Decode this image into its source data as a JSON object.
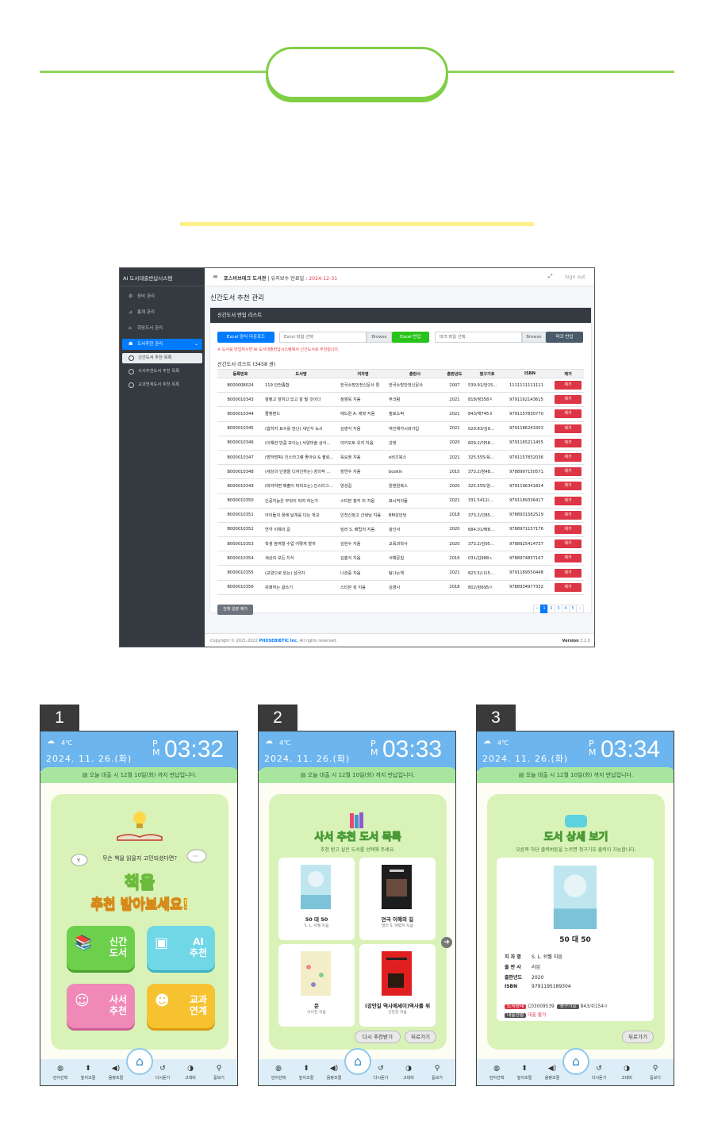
{
  "admin": {
    "brand": "AI 도서대출반납시스템",
    "sidebar": [
      {
        "label": "장비 관리",
        "icon": "gear-icon"
      },
      {
        "label": "통계 관리",
        "icon": "chart-icon"
      },
      {
        "label": "희망도서 관리",
        "icon": "gift-icon"
      },
      {
        "label": "도서추천 관리",
        "icon": "users-icon"
      }
    ],
    "submenu": [
      "신간도서 추천 목록",
      "사서추천도서 추천 목록",
      "교과연계도서 추천 목록"
    ],
    "topnav": {
      "school": "포스비브테크 도서관",
      "maint_label": "| 유지보수 만료일 :",
      "maint_date": "2024-12-31",
      "signout": "Sign out"
    },
    "page_title": "신간도서 추천 관리",
    "card_title": "신간도서 반입 리스트",
    "excel_download": "Excel 양식 다운로드",
    "excel_file_placeholder": "Excel 파일 선택",
    "browse": "Browse",
    "excel_import": "Excel 반입",
    "marc_file_placeholder": "마크 파일 선택",
    "marc_import": "마크 반입",
    "notice": "※ 도서를 반입하시면 AI 도서대출반납시스템에서 신간도서로 추천됩니다.",
    "list_title": "신간도서 리스트 (3458 권)",
    "columns": [
      "등록번호",
      "도서명",
      "저자명",
      "출판사",
      "출판년도",
      "청구기호",
      "ISBN",
      "제거"
    ],
    "remove": "제거",
    "rows": [
      [
        "B000008024",
        "119 안전종합",
        "한국소방안전신문사 편",
        "한국소방안전신문사",
        "2007",
        "539.91/한15…",
        "1111111111111"
      ],
      [
        "B000010343",
        "잘됐고 잘하고 있고 잘 될 것이다",
        "정영욱 지음",
        "부크럼",
        "2021",
        "818/정358ㅈ",
        "9791162143615"
      ],
      [
        "B000010344",
        "플랫랜드",
        "에드윈 A. 애벗 지음",
        "필로소픽",
        "2021",
        "843/애745ㅍ",
        "9791157830770"
      ],
      [
        "B000010345",
        "(쉽하지 표수를 만난) 세인식 녹시",
        "김영식 지음",
        "여인채카시와가입",
        "2021",
        "029.83/김9…",
        "9791186243303"
      ],
      [
        "B000010346",
        "(이해한 만큼 보이는) 서양미술 상식…",
        "야키모토 유지 지음",
        "강벗",
        "2020",
        "609.2/야58…",
        "9791165211455"
      ],
      [
        "B000010347",
        "(멍하멍픽) 인스타그램 좋아요 & 팔로…",
        "육요정 지음",
        "e비즈북스",
        "2021",
        "325.555/육…",
        "9791157832036"
      ],
      [
        "B000010348",
        "(세상의 인생을 디자인하는) 창의적 …",
        "장연수 지음",
        "bookin",
        "2015",
        "373.2/장48…",
        "9788997150571"
      ],
      [
        "B000010349",
        "(따라하면 매출이 따라오는) 인스타그…",
        "양성길",
        "원앤원북스",
        "2020",
        "325.555/양…",
        "9791196341824"
      ],
      [
        "B000010350",
        "인공지능은 무엇이 되려 하는가",
        "스티븐 핑커 외 지음",
        "표시적의들",
        "2021",
        "331.5412/…",
        "9791189336417"
      ],
      [
        "B000010351",
        "아이들의 꿈에 날개를 다는 학교",
        "인천신정고 선생님 지음",
        "BM성안당",
        "2018",
        "373.2/인85…",
        "9788931582529"
      ],
      [
        "B000010352",
        "연극 이해의 길",
        "밀러 S. 배럽저 지음",
        "광인서",
        "2020",
        "684.01/배8…",
        "9788971157176"
      ],
      [
        "B000010353",
        "학생 참여형 수업 어떻게 할까",
        "김현수 지음",
        "교육과학사",
        "2020",
        "373.2/김95…",
        "9788925414737"
      ],
      [
        "B000010354",
        "세상의 모든 지식",
        "김흥식 지음",
        "서해문집",
        "2016",
        "031/김988ㅅ",
        "9788974837167"
      ],
      [
        "B000010355",
        "(교양으로 읽는) 삼국지",
        "나관중 지음",
        "탐나는책",
        "2021",
        "823.5/나15…",
        "9791189550448"
      ],
      [
        "B000010356",
        "유쾌하는 글쓰기",
        "스티븐 킹 지음",
        "김영사",
        "2018",
        "802/킹695ㅇ",
        "9788934977332"
      ]
    ],
    "delete_all": "전체 일괄 제거",
    "pages": [
      "‹",
      "1",
      "2",
      "3",
      "4",
      "5",
      "›"
    ],
    "copyright_prefix": "Copyright © 2021-2022",
    "copyright_company": "PHOSEBIBTIC Inc.",
    "copyright_suffix": "All rights reserved.",
    "version_label": "Version",
    "version": "3.2.0"
  },
  "phones": {
    "temp": "4℃",
    "date": "2024. 11. 26.(화)",
    "ampm": "P M",
    "times": [
      "03:32",
      "03:33",
      "03:34"
    ],
    "notice": "오늘 대출 시 12월 10일(화) 까지 반납입니다.",
    "nav": [
      "언어선택",
      "높이조절",
      "음량조절",
      "다시듣기",
      "고대비",
      "돋보기"
    ],
    "badges": [
      "1",
      "2",
      "3"
    ],
    "p1": {
      "question": "무슨 책을 읽을지 고민되셨다면?",
      "big1": "책을",
      "big2": "추천 받아보세요!",
      "tiles": [
        "신간\n도서",
        "AI\n추천",
        "사서\n추천",
        "교과\n연계"
      ]
    },
    "p2": {
      "title": "사서 추천 도서 목록",
      "subtitle": "추천 받고 싶은 도서를 선택해 주세요.",
      "books": [
        {
          "title": "50 대 50",
          "author": "S. L. 쉬웰 지음"
        },
        {
          "title": "연극 이해의 길",
          "author": "밀러 S. 배럽저 지음"
        },
        {
          "title": "문",
          "author": "이이천 지음"
        },
        {
          "title": "(강만길 역사에세이)역사를 위",
          "author": "강만길 지음"
        }
      ],
      "again": "다시 추천받기",
      "back": "뒤로가기"
    },
    "p3": {
      "title": "도서 상세 보기",
      "subtitle": "오른쪽 하단 출력버튼을 누르면 청구기호 출력이 가능합니다.",
      "book_title": "50 대 50",
      "labels": [
        "지 자 명",
        "출 판 사",
        "출판년도",
        "ISBN"
      ],
      "values": [
        "S. L. 쉬웰 지음",
        "라임",
        "2020",
        "9791195189304"
      ],
      "tag1": "도서상태",
      "val1": "C03009539",
      "tag2": "청구기호",
      "val2": "843/쉬154ㅇ",
      "tag3": "대출현황",
      "val3": "대출 불가",
      "back": "뒤로가기"
    }
  },
  "colors": {
    "green_line": "#8dd35a",
    "sidebar": "#343a40",
    "primary": "#007bff",
    "danger": "#dc3545",
    "phone_header": "#6cb5ee"
  }
}
